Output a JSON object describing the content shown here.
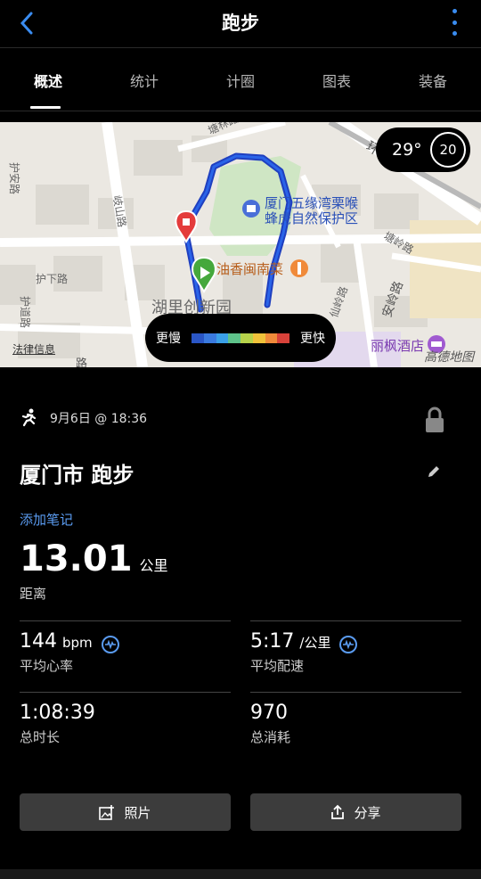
{
  "header": {
    "title": "跑步",
    "back_icon": "chevron-left-icon",
    "more_icon": "vertical-ellipsis-icon",
    "accent": "#3a8cf0"
  },
  "tabs": [
    {
      "label": "概述",
      "active": true
    },
    {
      "label": "统计",
      "active": false
    },
    {
      "label": "计圈",
      "active": false
    },
    {
      "label": "图表",
      "active": false
    },
    {
      "label": "装备",
      "active": false
    }
  ],
  "map": {
    "labels": {
      "park": "厦门五缘湾栗喉\n蜂虎自然保护区",
      "restaurant": "油香闽南菜",
      "district": "湖里创新园",
      "hotel": "丽枫酒店",
      "road_huan": "环岛",
      "road_huli": "护安路",
      "road_qishan": "岐山路",
      "road_huxia": "护下路",
      "road_hudao": "护道路",
      "road_xianling": "仙岭路",
      "road_anling": "安岭路",
      "road_tanglin": "塘林路",
      "road_lan": "塘岭路",
      "road_lu": "路"
    },
    "weather": {
      "temp": "29°",
      "wind": "20"
    },
    "legend": {
      "slow": "更慢",
      "fast": "更快",
      "colors": [
        "#2a56c6",
        "#3a7ae0",
        "#3aa0e8",
        "#5ec28a",
        "#b6d24a",
        "#f0c23a",
        "#f08a3a",
        "#d8423a"
      ]
    },
    "legal": "法律信息",
    "provider": "高德地图"
  },
  "activity": {
    "datetime": "9月6日 @ 18:36",
    "title": "厦门市 跑步",
    "add_note": "添加笔记",
    "distance": "13.01",
    "distance_unit": "公里",
    "distance_label": "距离"
  },
  "stats": {
    "heart_rate": {
      "value": "144",
      "unit": "bpm",
      "label": "平均心率"
    },
    "pace": {
      "value": "5:17",
      "unit": "/公里",
      "label": "平均配速"
    },
    "duration": {
      "value": "1:08:39",
      "label": "总时长"
    },
    "calories": {
      "value": "970",
      "label": "总消耗"
    }
  },
  "buttons": {
    "photo": "照片",
    "share": "分享"
  }
}
